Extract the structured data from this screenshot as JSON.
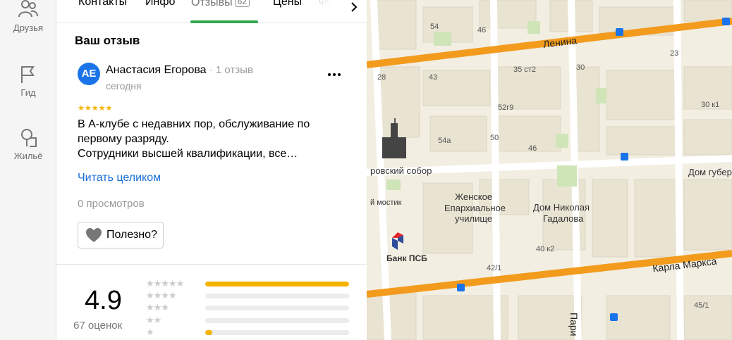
{
  "rail": {
    "items": [
      {
        "label": "Друзья",
        "icon": "friends-icon"
      },
      {
        "label": "Гид",
        "icon": "flag-icon"
      },
      {
        "label": "Жильё",
        "icon": "house-icon"
      }
    ]
  },
  "tabs": [
    {
      "label": "Контакты"
    },
    {
      "label": "Инфо"
    },
    {
      "label": "Отзывы",
      "badge": "62"
    },
    {
      "label": "Цены"
    },
    {
      "label": "Фо"
    }
  ],
  "review": {
    "section_title": "Ваш отзыв",
    "avatar_initials": "АЕ",
    "author": "Анастасия Егорова",
    "author_reviews": "1 отзыв",
    "date": "сегодня",
    "stars": "★★★★★",
    "text_line1": "В А-клубе с недавних пор, обслуживание по",
    "text_line2": "первому разряду.",
    "text_line3": "Сотрудники высшей квалификации, все…",
    "read_more": "Читать целиком",
    "views": "0 просмотров",
    "useful_label": "Полезно?"
  },
  "rating": {
    "value": "4.9",
    "count_label": "67 оценок",
    "distribution": [
      {
        "stars": "★★★★★",
        "fraction": 1.0
      },
      {
        "stars": "★★★★",
        "fraction": 0.0
      },
      {
        "stars": "★★★",
        "fraction": 0.0
      },
      {
        "stars": "★★",
        "fraction": 0.0
      },
      {
        "stars": "★",
        "fraction": 0.05
      }
    ]
  },
  "colors": {
    "accent_green": "#2fa84f",
    "star_yellow": "#f5b300",
    "link_blue": "#1a6ed8",
    "road_orange": "#f29b1d",
    "bank_red": "#e3262f",
    "bank_blue": "#2e4c9a"
  },
  "map": {
    "streets": [
      "Ленина",
      "Карла Маркса",
      "Пари"
    ],
    "places": [
      "ровский собор",
      "Женское",
      "Епархиальное",
      "училище",
      "Дом Николая",
      "Гадалова",
      "Дом губер",
      "Банк ПСБ",
      "й мостик"
    ],
    "numbers": [
      "54",
      "46",
      "23",
      "43",
      "35 ст2",
      "30",
      "28",
      "52г9",
      "30 к1",
      "54а",
      "50",
      "46",
      "40 к2",
      "42/1",
      "45/1"
    ]
  }
}
